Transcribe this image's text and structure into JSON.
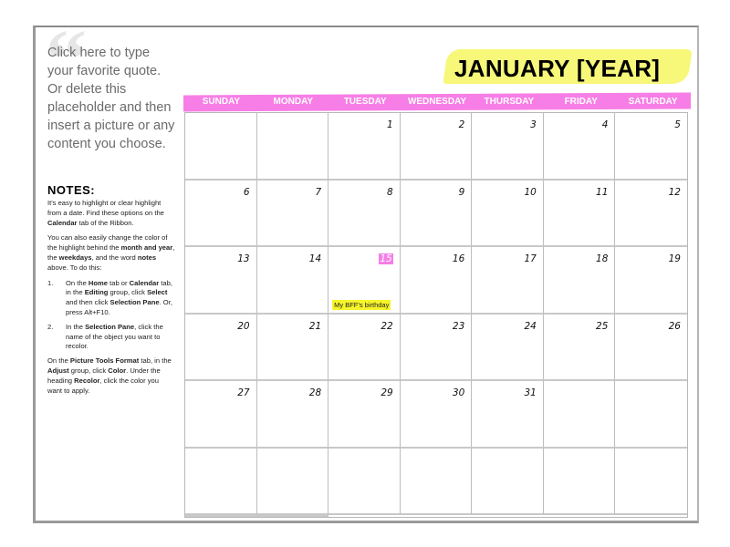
{
  "sidebar": {
    "quote_mark": "“",
    "quote_placeholder": "Click here to type your favorite quote. Or delete this placeholder and then insert a picture or any content you choose.",
    "notes_title": "NOTES:",
    "notes_p1_a": "It's easy to highlight or clear highlight from a date. Find these options on the ",
    "notes_p1_b": "Calendar",
    "notes_p1_c": " tab of the Ribbon.",
    "notes_p2_a": "You can also easily change the color of the highlight behind the ",
    "notes_p2_b": "month and year",
    "notes_p2_c": ", the ",
    "notes_p2_d": "weekdays",
    "notes_p2_e": ", and the word ",
    "notes_p2_f": "notes",
    "notes_p2_g": " above. To do this:",
    "step1_num": "1.",
    "step1_a": "On the ",
    "step1_b": "Home",
    "step1_c": " tab or ",
    "step1_d": "Calendar",
    "step1_e": " tab, in the ",
    "step1_f": "Editing",
    "step1_g": " group, click ",
    "step1_h": "Select",
    "step1_i": " and then click ",
    "step1_j": "Selection Pane",
    "step1_k": ". Or, press Alt+F10.",
    "step2_num": "2.",
    "step2_a": "In the ",
    "step2_b": "Selection Pane",
    "step2_c": ", click the name of the object you want to recolor.",
    "notes_p3_a": "On the ",
    "notes_p3_b": "Picture Tools Format",
    "notes_p3_c": " tab, in the ",
    "notes_p3_d": "Adjust",
    "notes_p3_e": " group, click ",
    "notes_p3_f": "Color",
    "notes_p3_g": ". Under the heading ",
    "notes_p3_h": "Recolor",
    "notes_p3_i": ", click the color you want to apply."
  },
  "calendar": {
    "title": "JANUARY [YEAR]",
    "weekdays": [
      "SUNDAY",
      "MONDAY",
      "TUESDAY",
      "WEDNESDAY",
      "THURSDAY",
      "FRIDAY",
      "SATURDAY"
    ],
    "days": [
      "",
      "",
      "1",
      "2",
      "3",
      "4",
      "5",
      "6",
      "7",
      "8",
      "9",
      "10",
      "11",
      "12",
      "13",
      "14",
      "15",
      "16",
      "17",
      "18",
      "19",
      "20",
      "21",
      "22",
      "23",
      "24",
      "25",
      "26",
      "27",
      "28",
      "29",
      "30",
      "31",
      "",
      "",
      "",
      "",
      "",
      "",
      "",
      "",
      "",
      "",
      ""
    ],
    "highlighted_day": "15",
    "event": {
      "day": "15",
      "text": "My BFF's birthday"
    },
    "colors": {
      "month_highlight": "#f7f77a",
      "weekday_band": "#f77ee6",
      "event_highlight": "#f7f52a"
    }
  }
}
